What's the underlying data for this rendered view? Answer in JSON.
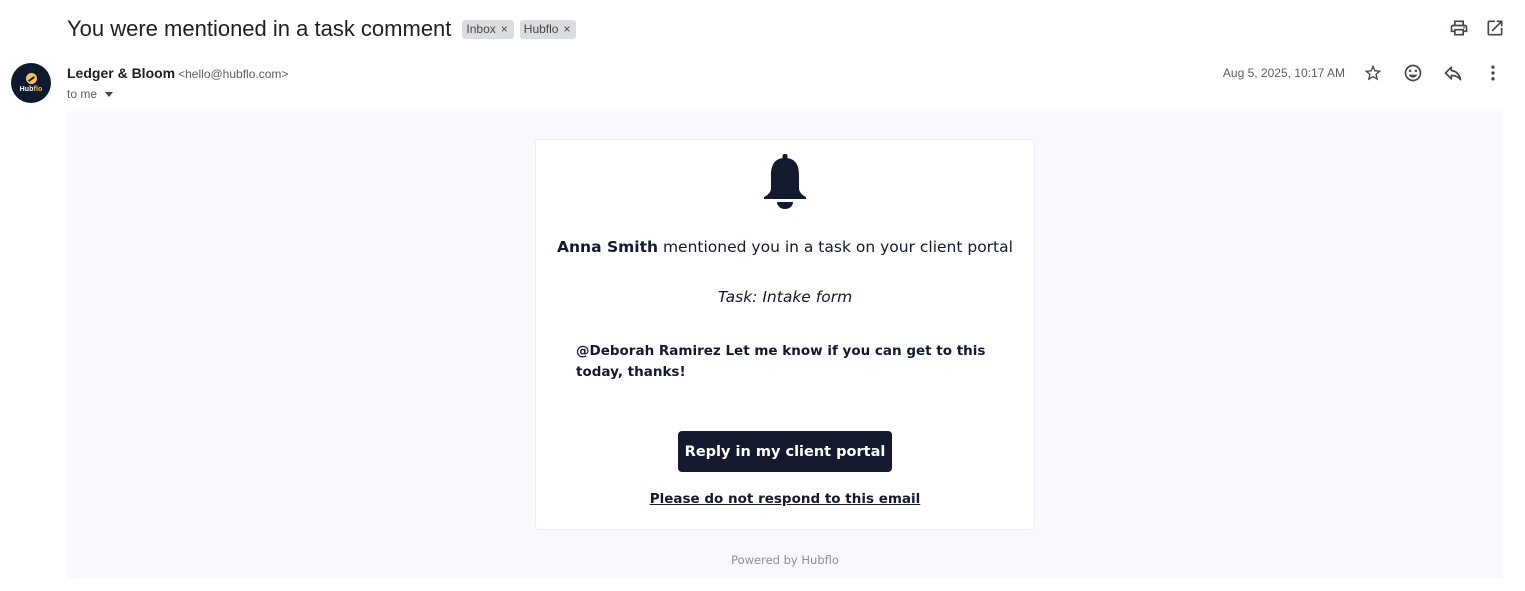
{
  "email": {
    "subject": "You were mentioned in a task comment",
    "labels": [
      {
        "name": "Inbox",
        "remove": "×"
      },
      {
        "name": "Hubflo",
        "remove": "×"
      }
    ],
    "sender_name": "Ledger & Bloom",
    "sender_email": "<hello@hubflo.com>",
    "to": "to me",
    "date": "Aug 5, 2025, 10:17 AM",
    "avatar_brand_a": "Hub",
    "avatar_brand_b": "flo"
  },
  "icons": {
    "print": "print-icon",
    "open_new_window": "open-in-new-window-icon",
    "star": "star-icon",
    "emoji": "emoji-icon",
    "reply": "reply-icon",
    "more": "more-vertical-icon",
    "bell": "bell-icon"
  },
  "message": {
    "mention_author": "Anna Smith",
    "mention_text": " mentioned you in a task on your client portal",
    "task": "Task: Intake form",
    "comment": "@Deborah Ramirez Let me know if you can get to this today, thanks!",
    "cta_label": "Reply in my client portal",
    "no_reply_text": "Please do not respond to this email",
    "powered_by": "Powered by Hubflo"
  },
  "colors": {
    "brand_dark": "#131a2e",
    "brand_accent": "#f5c35a",
    "body_background": "#f8f9fc"
  }
}
